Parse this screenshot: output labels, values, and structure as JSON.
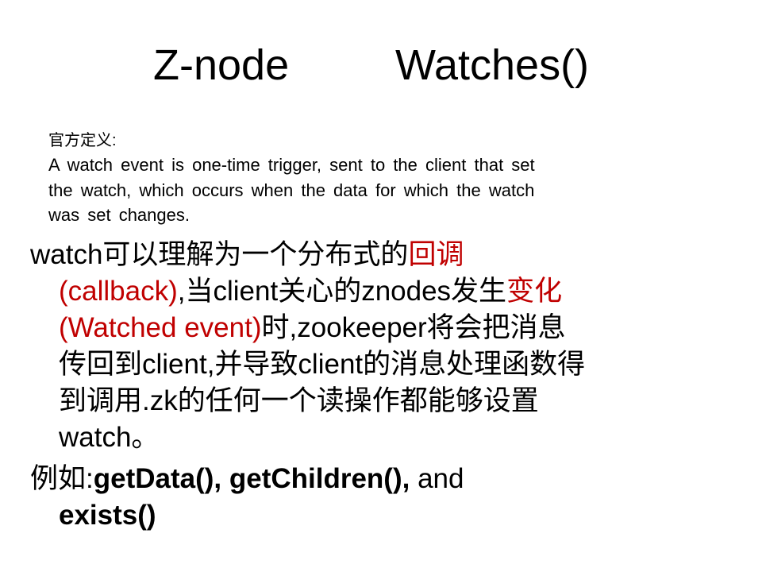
{
  "title": {
    "left": "Z-node",
    "right": "Watches()"
  },
  "definition": {
    "label": "官方定义:",
    "lines": [
      "A watch event is one-time trigger, sent to the client that set",
      "the watch, which occurs when the data for which the watch",
      "was set changes."
    ]
  },
  "bullet1": {
    "l1_a": "watch可以理解为一个分布式的",
    "l1_b": "回调",
    "l2_a": "(callback)",
    "l2_b": ",当client关心的znodes发生",
    "l2_c": "变化",
    "l3_a": "(Watched  event)",
    "l3_b": "时,zookeeper将会把消息",
    "l4": "传回到client,并导致client的消息处理函数得",
    "l5": "到调用.zk的任何一个读操作都能够设置",
    "l6": "watch。"
  },
  "bullet2": {
    "prefix": "例如:",
    "fn1": "getData(),  getChildren(),",
    "and": " and",
    "fn2": "exists()"
  },
  "colors": {
    "highlight": "#c00000",
    "text": "#000000",
    "background": "#ffffff"
  }
}
